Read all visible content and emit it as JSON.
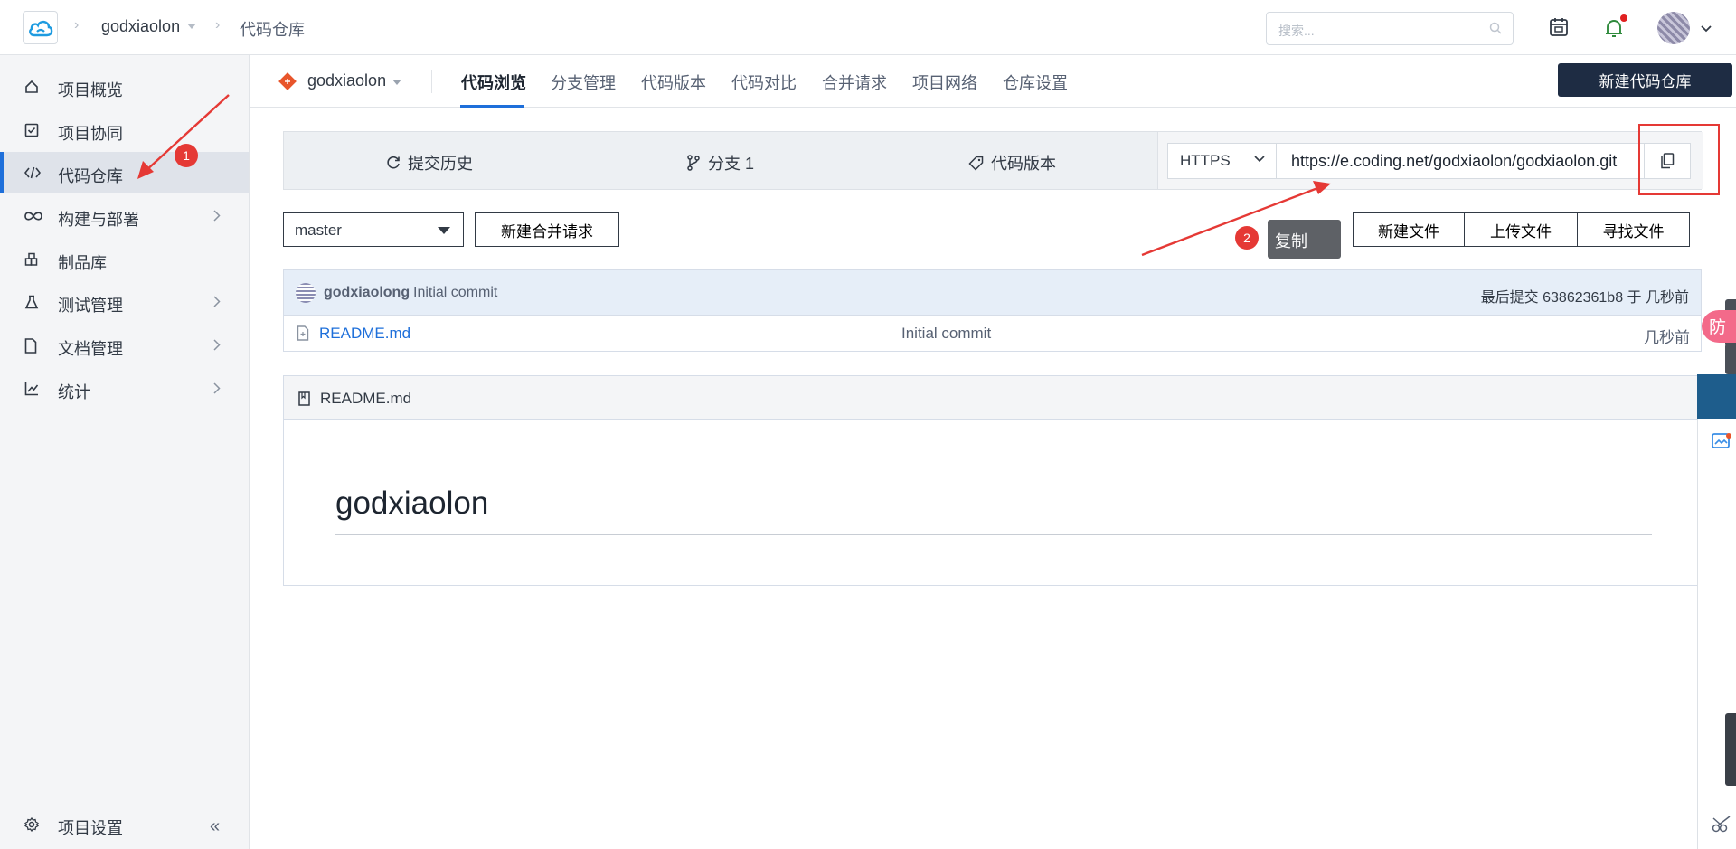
{
  "header": {
    "crumb_project": "godxiaolon",
    "crumb_page": "代码仓库",
    "search_placeholder": "搜索..."
  },
  "sidebar": {
    "items": [
      {
        "label": "项目概览",
        "icon": "home-icon"
      },
      {
        "label": "项目协同",
        "icon": "checkbox-icon"
      },
      {
        "label": "代码仓库",
        "icon": "code-icon",
        "active": true
      },
      {
        "label": "构建与部署",
        "icon": "infinity-icon",
        "has_children": true
      },
      {
        "label": "制品库",
        "icon": "package-icon"
      },
      {
        "label": "测试管理",
        "icon": "flask-icon",
        "has_children": true
      },
      {
        "label": "文档管理",
        "icon": "document-icon",
        "has_children": true
      },
      {
        "label": "统计",
        "icon": "chart-icon",
        "has_children": true
      }
    ],
    "settings_label": "项目设置",
    "collapse_glyph": "«"
  },
  "repo_nav": {
    "repo_name": "godxiaolon",
    "tabs": [
      "代码浏览",
      "分支管理",
      "代码版本",
      "代码对比",
      "合并请求",
      "项目网络",
      "仓库设置"
    ],
    "active_tab": "代码浏览",
    "new_repo_button": "新建代码仓库"
  },
  "stats": {
    "history": "提交历史",
    "branches": "分支 1",
    "tags": "代码版本"
  },
  "clone": {
    "protocol": "HTTPS",
    "url": "https://e.coding.net/godxiaolon/godxiaolon.git"
  },
  "branch": {
    "selected": "master",
    "merge_request_button": "新建合并请求"
  },
  "tooltip": "复制",
  "file_actions": [
    "新建文件",
    "上传文件",
    "寻找文件"
  ],
  "last_commit": {
    "author": "godxiaolong",
    "message": "Initial commit",
    "meta": "最后提交 63862361b8 于 几秒前"
  },
  "files": [
    {
      "name": "README.md",
      "message": "Initial commit",
      "time": "几秒前"
    }
  ],
  "readme": {
    "filename": "README.md",
    "heading": "godxiaolon"
  },
  "annotations": {
    "step1": "1",
    "step2": "2",
    "color": "#e53935"
  },
  "edge_widget_text": "防疫",
  "colors": {
    "accent": "#1e6fda",
    "primary_button": "#1e2c43",
    "sidebar_bg": "#f4f5f7"
  }
}
